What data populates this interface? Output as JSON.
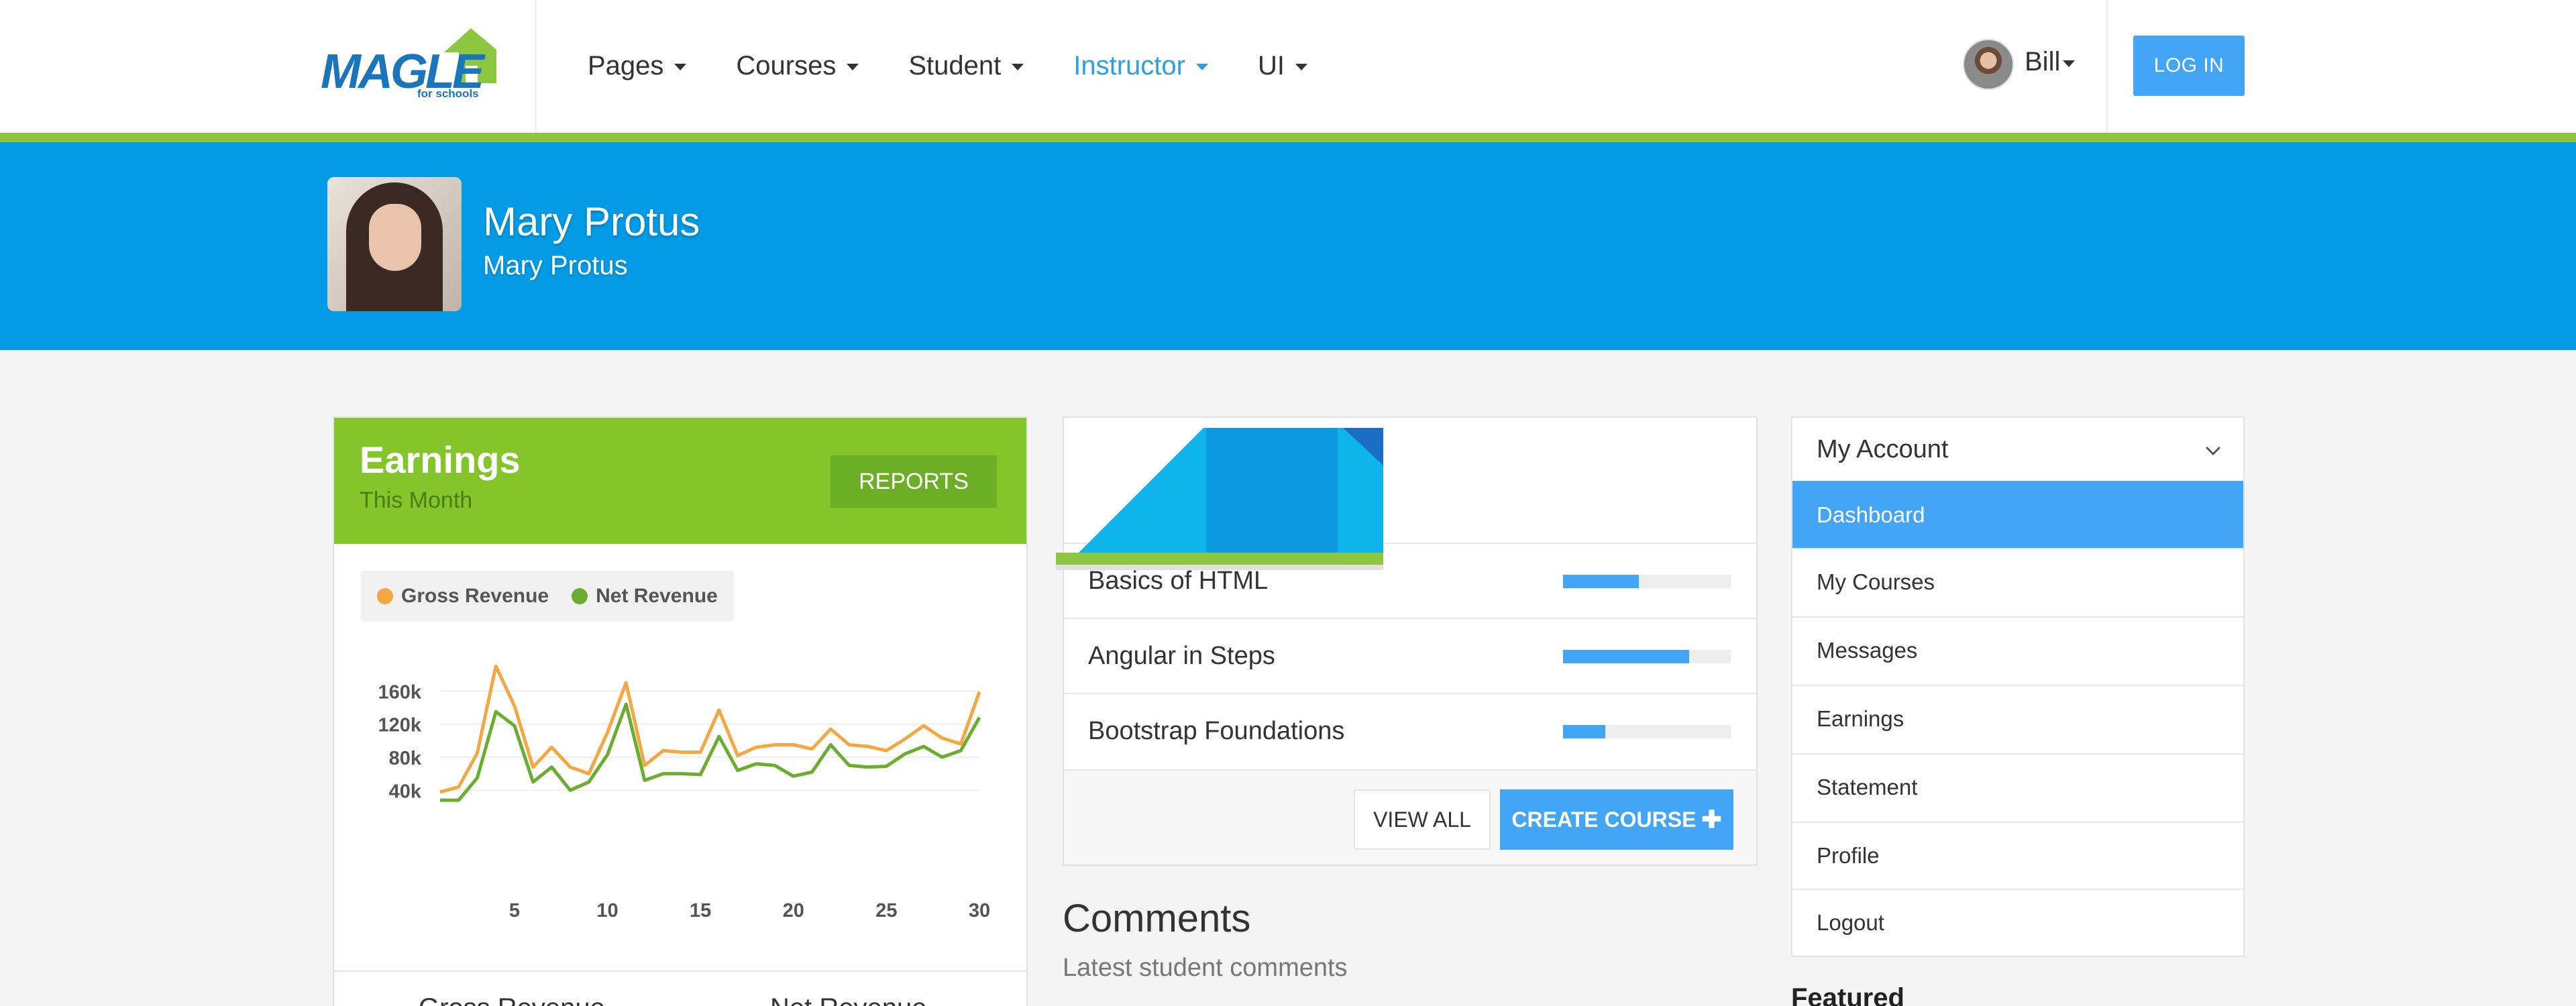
{
  "brand": {
    "logo_text": "MAGLE",
    "logo_sub": "for schools",
    "colors": {
      "primary": "#039be5",
      "accent_green": "#8dc63f",
      "button_blue": "#42a5f5",
      "logo_blue": "#1b75bb"
    }
  },
  "nav": {
    "items": [
      {
        "label": "Pages",
        "active": false
      },
      {
        "label": "Courses",
        "active": false
      },
      {
        "label": "Student",
        "active": false
      },
      {
        "label": "Instructor",
        "active": true
      },
      {
        "label": "UI",
        "active": false
      }
    ],
    "user_name": "Bill",
    "login_label": "LOG IN"
  },
  "hero": {
    "name": "Mary Protus",
    "subtitle": "Mary Protus"
  },
  "earnings": {
    "title": "Earnings",
    "subtitle": "This Month",
    "reports_label": "REPORTS",
    "footer_left": "Gross Revenue",
    "footer_right": "Net Revenue",
    "legend": [
      {
        "name": "Gross Revenue",
        "color": "#f5a742"
      },
      {
        "name": "Net Revenue",
        "color": "#6bae2f"
      }
    ]
  },
  "chart_data": {
    "type": "line",
    "x": [
      1,
      2,
      3,
      4,
      5,
      6,
      7,
      8,
      9,
      10,
      11,
      12,
      13,
      14,
      15,
      16,
      17,
      18,
      19,
      20,
      21,
      22,
      23,
      24,
      25,
      26,
      27,
      28,
      29,
      30
    ],
    "series": [
      {
        "name": "Gross Revenue",
        "color": "#f5a742",
        "values": [
          38000,
          44000,
          85000,
          190000,
          142000,
          68000,
          92000,
          68000,
          60000,
          110000,
          170000,
          70000,
          88000,
          86000,
          86000,
          137000,
          82000,
          92000,
          95000,
          95000,
          90000,
          114000,
          95000,
          93000,
          88000,
          102000,
          118000,
          103000,
          96000,
          159000
        ]
      },
      {
        "name": "Net Revenue",
        "color": "#6bae2f",
        "values": [
          28000,
          28000,
          55000,
          135000,
          118000,
          50000,
          68000,
          40000,
          50000,
          83000,
          144000,
          52000,
          60000,
          60000,
          59000,
          105000,
          64000,
          72000,
          70000,
          57000,
          62000,
          95000,
          70000,
          68000,
          69000,
          84000,
          93000,
          80000,
          88000,
          128000
        ]
      }
    ],
    "ylim": [
      20000,
      200000
    ],
    "y_ticks": [
      40000,
      80000,
      120000,
      160000
    ],
    "y_tick_labels": [
      "40k",
      "80k",
      "120k",
      "160k"
    ],
    "x_ticks": [
      5,
      10,
      15,
      20,
      25,
      30
    ],
    "grid": true,
    "legend_position": "top-left"
  },
  "courses": {
    "rows": [
      {
        "title": "Basics of HTML",
        "progress": 0.45
      },
      {
        "title": "Angular in Steps",
        "progress": 0.75
      },
      {
        "title": "Bootstrap Foundations",
        "progress": 0.25
      }
    ],
    "view_all_label": "VIEW ALL",
    "create_label": "CREATE COURSE"
  },
  "comments": {
    "title": "Comments",
    "subtitle": "Latest student comments"
  },
  "account": {
    "title": "My Account",
    "items": [
      {
        "label": "Dashboard",
        "active": true
      },
      {
        "label": "My Courses",
        "active": false
      },
      {
        "label": "Messages",
        "active": false
      },
      {
        "label": "Earnings",
        "active": false
      },
      {
        "label": "Statement",
        "active": false
      },
      {
        "label": "Profile",
        "active": false
      },
      {
        "label": "Logout",
        "active": false
      }
    ],
    "featured_label": "Featured"
  }
}
